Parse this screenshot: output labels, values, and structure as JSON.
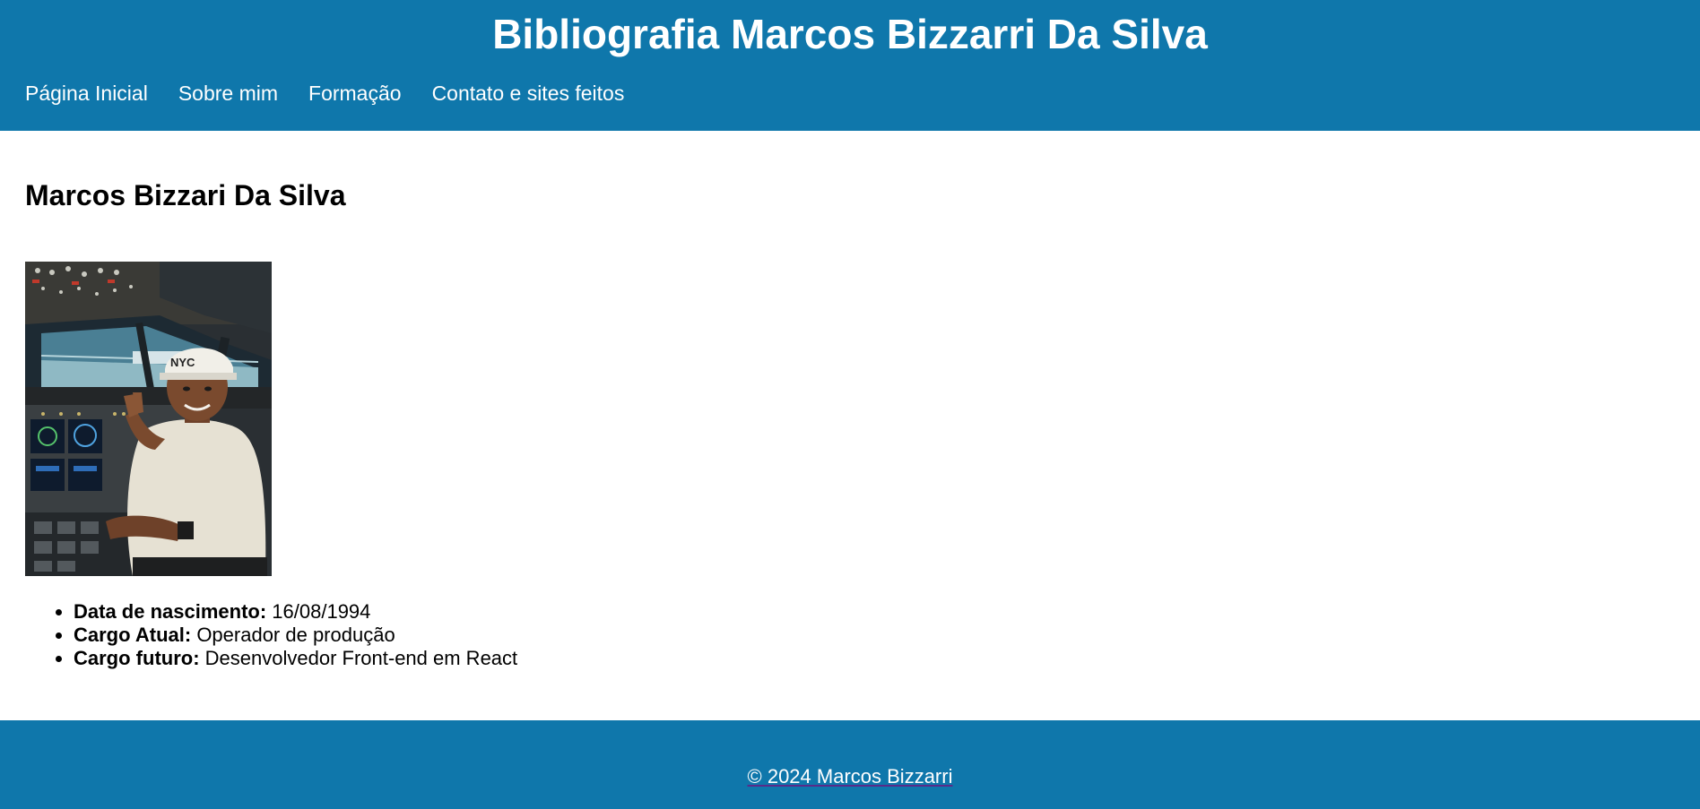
{
  "header": {
    "title": "Bibliografia Marcos Bizzarri Da Silva",
    "nav": [
      {
        "label": "Página Inicial"
      },
      {
        "label": "Sobre mim"
      },
      {
        "label": "Formação"
      },
      {
        "label": "Contato e sites feitos"
      }
    ]
  },
  "main": {
    "heading": "Marcos Bizzari Da Silva",
    "photo": {
      "cap_text": "NYC"
    },
    "info": [
      {
        "label": "Data de nascimento:",
        "value": "16/08/1994"
      },
      {
        "label": "Cargo Atual:",
        "value": "Operador de produção"
      },
      {
        "label": "Cargo futuro:",
        "value": "Desenvolvedor Front-end em React"
      }
    ]
  },
  "footer": {
    "text": "© 2024 Marcos Bizzarri"
  },
  "colors": {
    "brand": "#0f77ab",
    "text": "#000000",
    "header_text": "#ffffff"
  }
}
